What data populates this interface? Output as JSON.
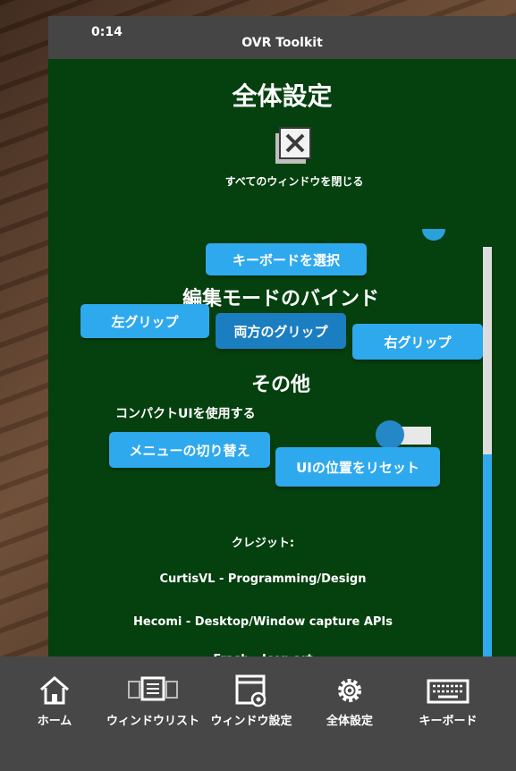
{
  "titlebar": {
    "time": "0:14",
    "app_title": "OVR Toolkit"
  },
  "page": {
    "title": "全体設定"
  },
  "close_all": {
    "label": "すべてのウィンドウを閉じる",
    "icon": "close-window-icon"
  },
  "keyboard_select": {
    "label": "キーボードを選択"
  },
  "edit_mode_bind": {
    "heading": "編集モードのバインド",
    "buttons": [
      {
        "label": "左グリップ",
        "active": false
      },
      {
        "label": "両方のグリップ",
        "active": true
      },
      {
        "label": "右グリップ",
        "active": false
      }
    ]
  },
  "other": {
    "heading": "その他",
    "compact_ui_label": "コンパクトUIを使用する",
    "compact_ui_enabled": false,
    "menu_toggle_label": "メニューの切り替え",
    "reset_ui_label": "UIの位置をリセット"
  },
  "credits": {
    "heading": "クレジット:",
    "lines": [
      "CurtisVL - Programming/Design",
      "Hecomi - Desktop/Window capture APIs",
      "Frash - Icon art"
    ]
  },
  "nav": {
    "items": [
      {
        "label": "ホーム",
        "icon": "home-icon"
      },
      {
        "label": "ウィンドウリスト",
        "icon": "window-list-icon"
      },
      {
        "label": "ウィンドウ設定",
        "icon": "window-settings-icon"
      },
      {
        "label": "全体設定",
        "icon": "gear-icon"
      },
      {
        "label": "キーボード",
        "icon": "keyboard-icon"
      }
    ]
  },
  "colors": {
    "panel_bg": "#05400f",
    "accent": "#2fa9ee",
    "bar_bg": "#454545"
  }
}
